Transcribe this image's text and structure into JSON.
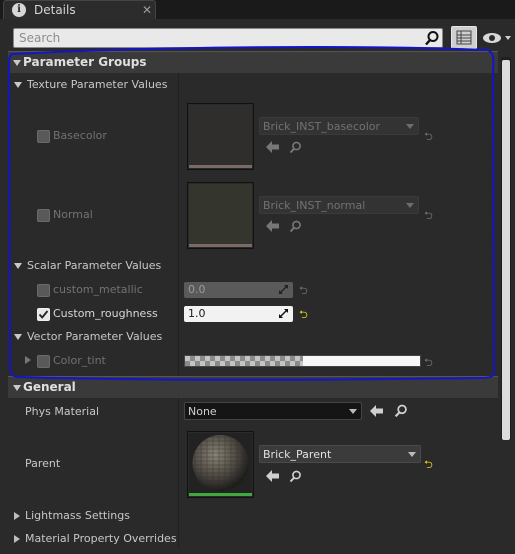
{
  "tab": {
    "title": "Details",
    "close": "✕",
    "icon_glyph": "i"
  },
  "search": {
    "placeholder": "Search"
  },
  "groups": {
    "title": "Parameter Groups",
    "texture": {
      "title": "Texture Parameter Values",
      "items": [
        {
          "label": "Basecolor",
          "asset": "Brick_INST_basecolor",
          "enabled": false
        },
        {
          "label": "Normal",
          "asset": "Brick_INST_normal",
          "enabled": false
        }
      ]
    },
    "scalar": {
      "title": "Scalar Parameter Values",
      "items": [
        {
          "label": "custom_metallic",
          "value": "0.0",
          "enabled": false
        },
        {
          "label": "Custom_roughness",
          "value": "1.0",
          "enabled": true
        }
      ]
    },
    "vector": {
      "title": "Vector Parameter Values",
      "items": [
        {
          "label": "Color_tint",
          "enabled": false
        }
      ]
    }
  },
  "general": {
    "title": "General",
    "phys_material": {
      "label": "Phys Material",
      "value": "None"
    },
    "parent": {
      "label": "Parent",
      "value": "Brick_Parent"
    },
    "lightmass": "Lightmass Settings",
    "overrides": "Material Property Overrides"
  },
  "icons": {
    "search": "search-icon",
    "arrow": "arrow-left-icon",
    "reset": "reset-arrow-icon",
    "eye": "eye-icon",
    "list": "list-view-icon"
  },
  "colors": {
    "annotation": "#1414c8",
    "reset_active": "#e0d020",
    "parent_thumb_bar": "#3fa93f"
  }
}
